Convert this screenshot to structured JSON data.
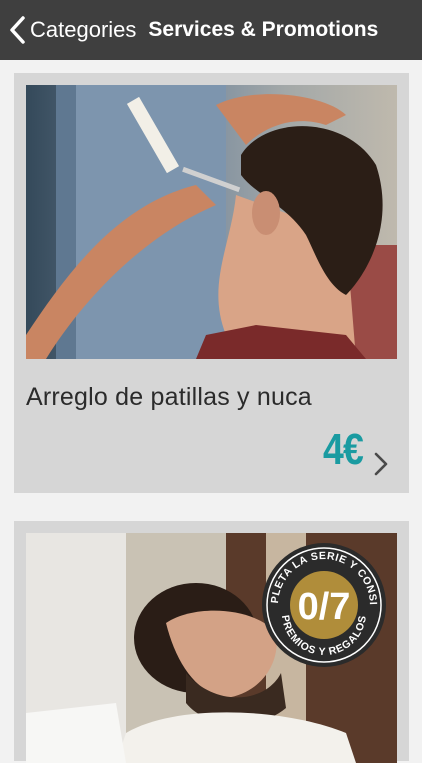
{
  "nav": {
    "back_label": "Categories",
    "title": "Services & Promotions"
  },
  "cards": [
    {
      "title": "Arreglo de patillas y nuca",
      "price": "4€"
    },
    {
      "badge": {
        "count": "0/7",
        "text": "COMPLETA LA SERIE Y CONSIGUE PREMIOS Y REGALOS"
      }
    }
  ],
  "colors": {
    "nav_bg": "#3f3f3f",
    "card_bg": "#d6d6d6",
    "price": "#1a9ba1",
    "badge_gold": "#b08d3a"
  }
}
